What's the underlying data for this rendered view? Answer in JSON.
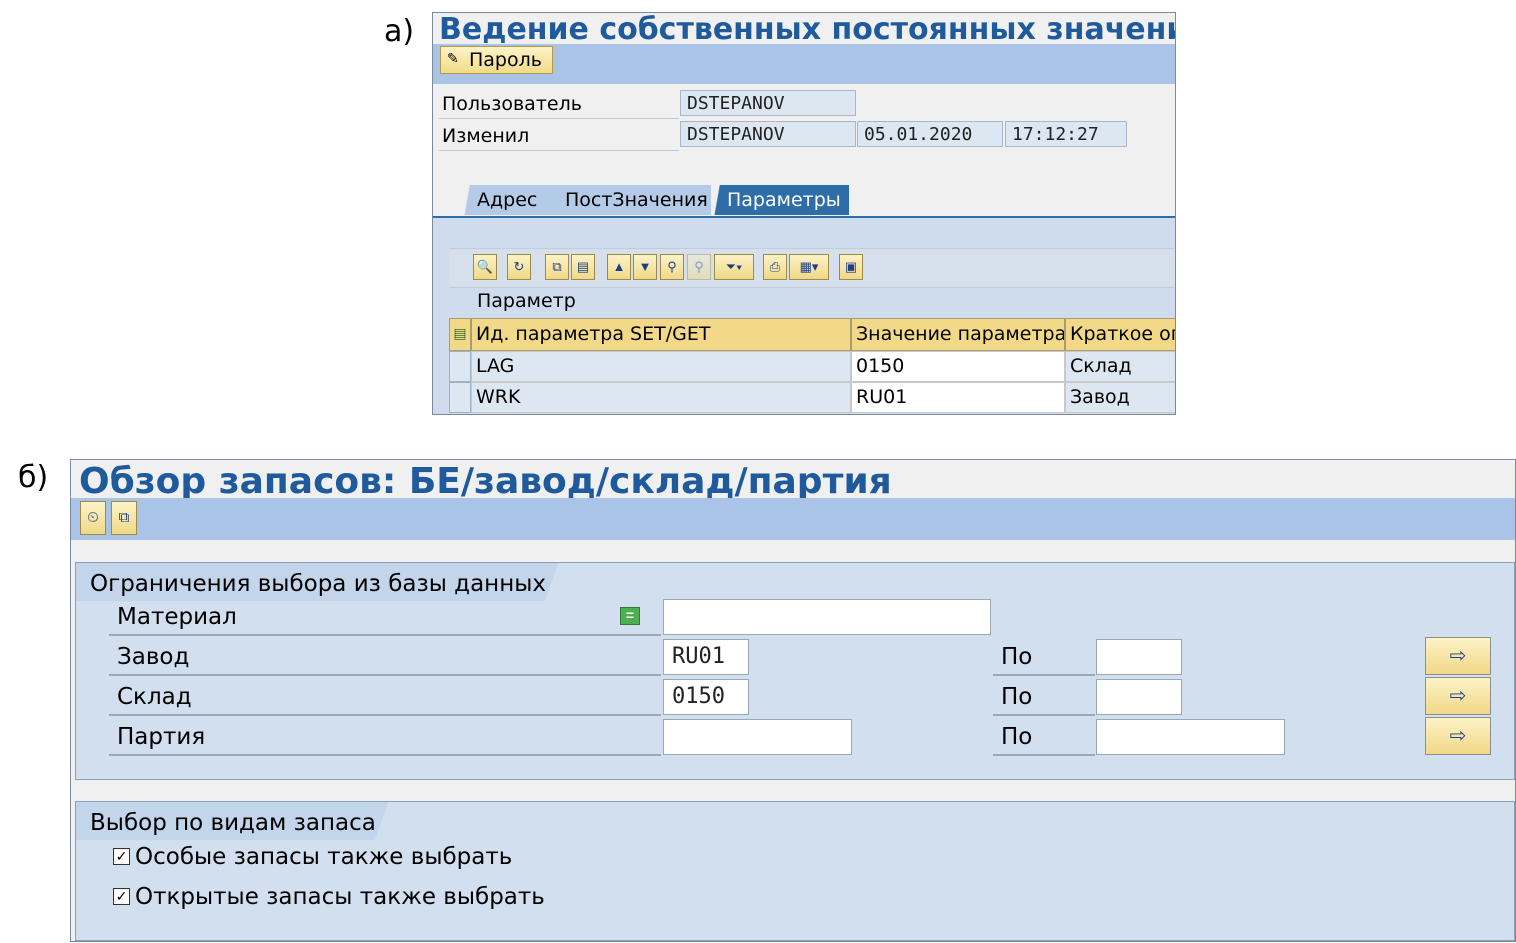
{
  "labels": {
    "a": "а)",
    "b": "б)"
  },
  "panelA": {
    "title": "Ведение собственных постоянных значений",
    "password_button": "Пароль",
    "user_label": "Пользователь",
    "user_value": "DSTEPANOV",
    "changed_label": "Изменил",
    "changed_value": "DSTEPANOV",
    "changed_date": "05.01.2020",
    "changed_time": "17:12:27",
    "tabs": [
      {
        "label": "Адрес",
        "active": false
      },
      {
        "label": "ПостЗначения",
        "active": false
      },
      {
        "label": "Параметры",
        "active": true
      }
    ],
    "grid_title": "Параметр",
    "columns": [
      "Ид. параметра SET/GET",
      "Значение параметра",
      "Краткое оп"
    ],
    "rows": [
      {
        "id": "LAG",
        "value": "0150",
        "desc": "Склад"
      },
      {
        "id": "WRK",
        "value": "RU01",
        "desc": "Завод"
      }
    ],
    "toolbar_icons": [
      "details-icon",
      "refresh-icon",
      "copy-icon",
      "paste-icon",
      "sort-asc-icon",
      "sort-desc-icon",
      "find-icon",
      "find-next-icon",
      "filter-icon",
      "print-icon",
      "layout-icon",
      "export-icon"
    ]
  },
  "panelB": {
    "title": "Обзор запасов: БЕ/завод/склад/партия",
    "toolbar_icons": [
      "execute-icon",
      "variant-icon"
    ],
    "group1_title": "Ограничения выбора из базы данных",
    "fields": [
      {
        "label": "Материал",
        "value": "",
        "to_label": "",
        "to_value": ""
      },
      {
        "label": "Завод",
        "value": "RU01",
        "to_label": "По",
        "to_value": ""
      },
      {
        "label": "Склад",
        "value": "0150",
        "to_label": "По",
        "to_value": ""
      },
      {
        "label": "Партия",
        "value": "",
        "to_label": "По",
        "to_value": ""
      }
    ],
    "group2_title": "Выбор по видам запаса",
    "checkboxes": [
      {
        "label": "Особые запасы также выбрать",
        "checked": true
      },
      {
        "label": "Открытые запасы также выбрать",
        "checked": true
      }
    ]
  }
}
